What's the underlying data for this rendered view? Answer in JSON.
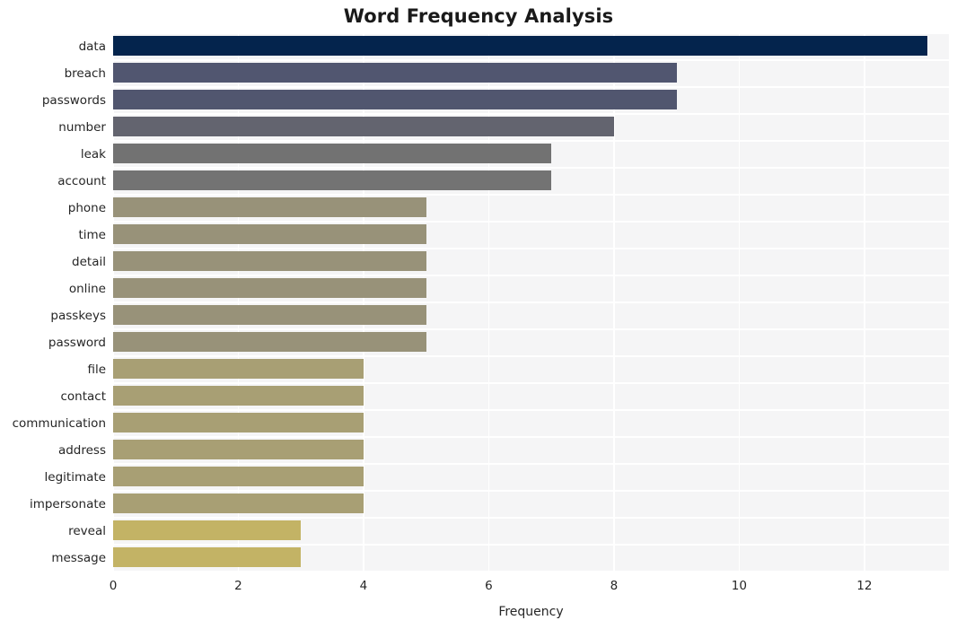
{
  "chart_data": {
    "type": "bar",
    "orientation": "horizontal",
    "title": "Word Frequency Analysis",
    "xlabel": "Frequency",
    "ylabel": "",
    "xlim": [
      0,
      13.35
    ],
    "ylim": [
      0,
      20
    ],
    "grid": true,
    "legend": null,
    "xticks": [
      "0",
      "2",
      "4",
      "6",
      "8",
      "10",
      "12"
    ],
    "xtick_values": [
      0,
      2,
      4,
      6,
      8,
      10,
      12
    ],
    "categories": [
      "data",
      "breach",
      "passwords",
      "number",
      "leak",
      "account",
      "phone",
      "time",
      "detail",
      "online",
      "passkeys",
      "password",
      "file",
      "contact",
      "communication",
      "address",
      "legitimate",
      "impersonate",
      "reveal",
      "message"
    ],
    "values": [
      13,
      9,
      9,
      8,
      7,
      7,
      5,
      5,
      5,
      5,
      5,
      5,
      4,
      4,
      4,
      4,
      4,
      4,
      3,
      3
    ],
    "bar_colors": [
      "#04244d",
      "#515670",
      "#51566f",
      "#63646f",
      "#727272",
      "#737373",
      "#989279",
      "#989279",
      "#989279",
      "#989279",
      "#989279",
      "#989279",
      "#a89f74",
      "#a89f74",
      "#a89f74",
      "#a89f74",
      "#a89f74",
      "#a89f74",
      "#c3b365",
      "#c3b365"
    ],
    "plot_background": "#f5f5f6",
    "grid_color": "#ffffff",
    "figure_background": "#ffffff",
    "text_color": "#262626"
  }
}
